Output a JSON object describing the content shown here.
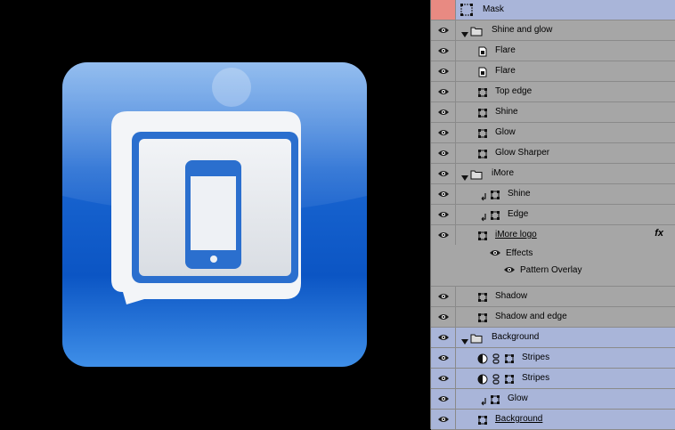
{
  "layers": [
    {
      "name": "Mask",
      "type": "mask",
      "indent": 0,
      "visible": false,
      "selected": true,
      "mask_row": true
    },
    {
      "name": "Shine and glow",
      "type": "group",
      "indent": 0,
      "visible": true
    },
    {
      "name": "Flare",
      "type": "smart",
      "indent": 1,
      "visible": true
    },
    {
      "name": "Flare",
      "type": "smart",
      "indent": 1,
      "visible": true
    },
    {
      "name": "Top edge",
      "type": "shape",
      "indent": 1,
      "visible": true
    },
    {
      "name": "Shine",
      "type": "shape",
      "indent": 1,
      "visible": true
    },
    {
      "name": "Glow",
      "type": "shape",
      "indent": 1,
      "visible": true
    },
    {
      "name": "Glow Sharper",
      "type": "shape",
      "indent": 1,
      "visible": true
    },
    {
      "name": "iMore",
      "type": "group",
      "indent": 0,
      "visible": true
    },
    {
      "name": "Shine",
      "type": "shape",
      "indent": 1,
      "clipped": true,
      "visible": true
    },
    {
      "name": "Edge",
      "type": "shape",
      "indent": 1,
      "clipped": true,
      "visible": true
    },
    {
      "name": "iMore logo",
      "type": "shape",
      "indent": 1,
      "visible": true,
      "underline": true,
      "fx": "fx",
      "effects": [
        "Effects",
        "Pattern Overlay"
      ]
    },
    {
      "name": "Shadow",
      "type": "shape",
      "indent": 1,
      "visible": true
    },
    {
      "name": "Shadow and edge",
      "type": "shape",
      "indent": 1,
      "visible": true
    },
    {
      "name": "Background",
      "type": "group",
      "indent": 0,
      "visible": true,
      "selected": true
    },
    {
      "name": "Stripes",
      "type": "adjust",
      "indent": 1,
      "visible": true,
      "selected": true
    },
    {
      "name": "Stripes",
      "type": "adjust",
      "indent": 1,
      "visible": true,
      "selected": true
    },
    {
      "name": "Glow",
      "type": "shape",
      "indent": 1,
      "clipped": true,
      "visible": true,
      "selected": true
    },
    {
      "name": "Background",
      "type": "shape",
      "indent": 1,
      "visible": true,
      "underline": true,
      "selected": true
    }
  ],
  "colors": {
    "panel_bg": "#a6a6a6",
    "selected_bg": "#a9b5d9",
    "mask_bg": "#e88a82",
    "icon_blue": "#1a66d1"
  }
}
